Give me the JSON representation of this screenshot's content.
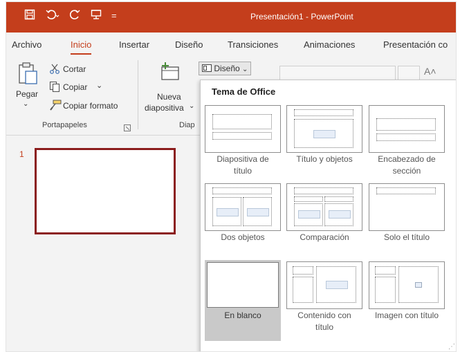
{
  "window": {
    "title": "Presentación1  -  PowerPoint"
  },
  "quick_access": {
    "save_icon": "save-icon",
    "undo_icon": "undo-icon",
    "redo_icon": "redo-icon",
    "present_icon": "present-icon",
    "customize": "="
  },
  "tabs": [
    {
      "label": "Archivo"
    },
    {
      "label": "Inicio"
    },
    {
      "label": "Insertar"
    },
    {
      "label": "Diseño"
    },
    {
      "label": "Transiciones"
    },
    {
      "label": "Animaciones"
    },
    {
      "label": "Presentación co"
    }
  ],
  "ribbon": {
    "paste_label": "Pegar",
    "cut_label": "Cortar",
    "copy_label": "Copiar",
    "copy_dropdown": "⌄",
    "format_painter_label": "Copiar formato",
    "clipboard_group": "Portapapeles",
    "new_slide_line1": "Nueva",
    "new_slide_line2": "diapositiva",
    "slides_group": "Diap",
    "layout_button": "Diseño",
    "font_grow": "A˄"
  },
  "slides": [
    {
      "number": "1"
    }
  ],
  "layout_gallery": {
    "heading": "Tema de Office",
    "layouts": [
      {
        "line1": "Diapositiva de",
        "line2": "título"
      },
      {
        "line1": "Título y objetos",
        "line2": ""
      },
      {
        "line1": "Encabezado de",
        "line2": "sección"
      },
      {
        "line1": "Dos objetos",
        "line2": ""
      },
      {
        "line1": "Comparación",
        "line2": ""
      },
      {
        "line1": "Solo el título",
        "line2": ""
      },
      {
        "line1": "En blanco",
        "line2": ""
      },
      {
        "line1": "Contenido con",
        "line2": "título"
      },
      {
        "line1": "Imagen con título",
        "line2": ""
      }
    ],
    "selected_index": 6
  },
  "colors": {
    "accent": "#c43e1c",
    "thumb_border": "#8b1c1c",
    "selected_bg": "#c9c9c9"
  }
}
